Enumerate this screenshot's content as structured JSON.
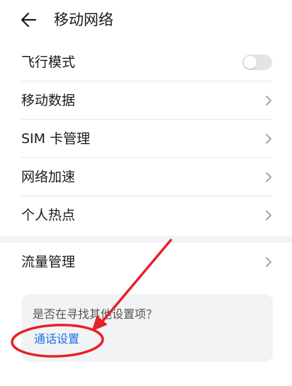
{
  "header": {
    "back_icon": "arrow-left-icon",
    "title": "移动网络"
  },
  "settings": {
    "airplane_mode": {
      "label": "飞行模式",
      "enabled": false
    },
    "mobile_data": {
      "label": "移动数据"
    },
    "sim_management": {
      "label": "SIM 卡管理"
    },
    "network_acceleration": {
      "label": "网络加速"
    },
    "personal_hotspot": {
      "label": "个人热点"
    },
    "data_usage": {
      "label": "流量管理"
    }
  },
  "suggestion": {
    "question": "是否在寻找其他设置项？",
    "link": "通话设置"
  },
  "colors": {
    "link_blue": "#1a6fe8",
    "annotation_red": "#e8202a",
    "toggle_off": "#e4e4e4",
    "card_bg": "#f2f3f5"
  }
}
